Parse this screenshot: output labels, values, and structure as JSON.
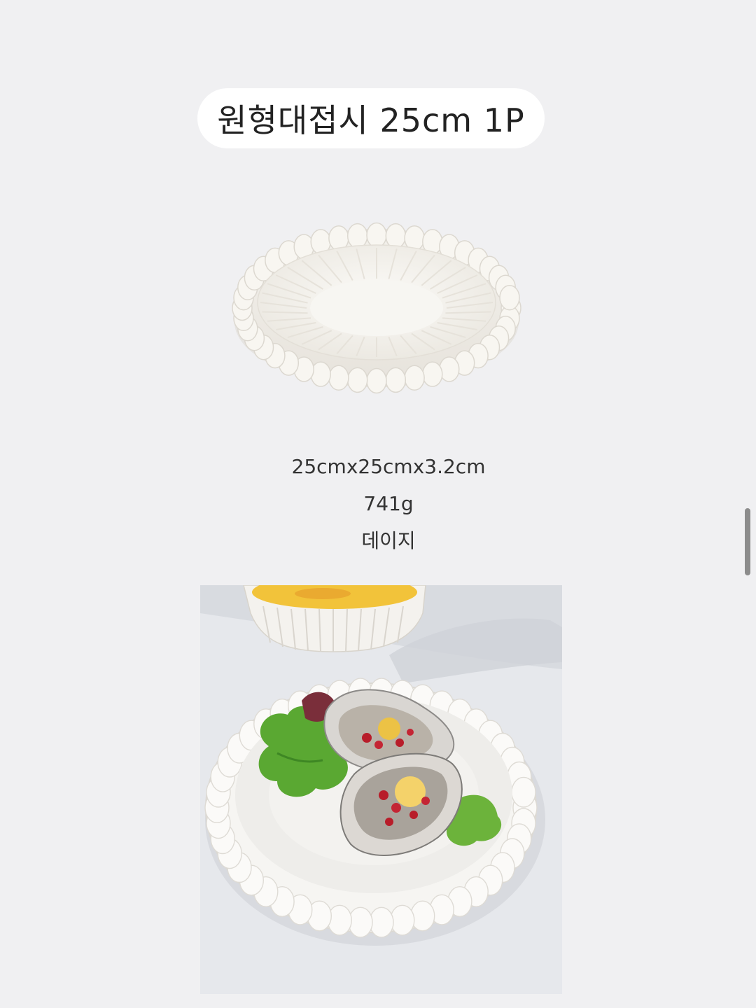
{
  "product": {
    "title": "원형대접시 25cm 1P",
    "dimensions": "25cmx25cmx3.2cm",
    "weight": "741g",
    "design_name": "데이지"
  },
  "colors": {
    "background": "#f0f0f2",
    "pill": "#ffffff",
    "plate": "#f5f3ee",
    "plate_shadow": "#ddd9d2",
    "text": "#222222"
  },
  "icons": {
    "scrollbar": "scrollbar-thumb"
  }
}
